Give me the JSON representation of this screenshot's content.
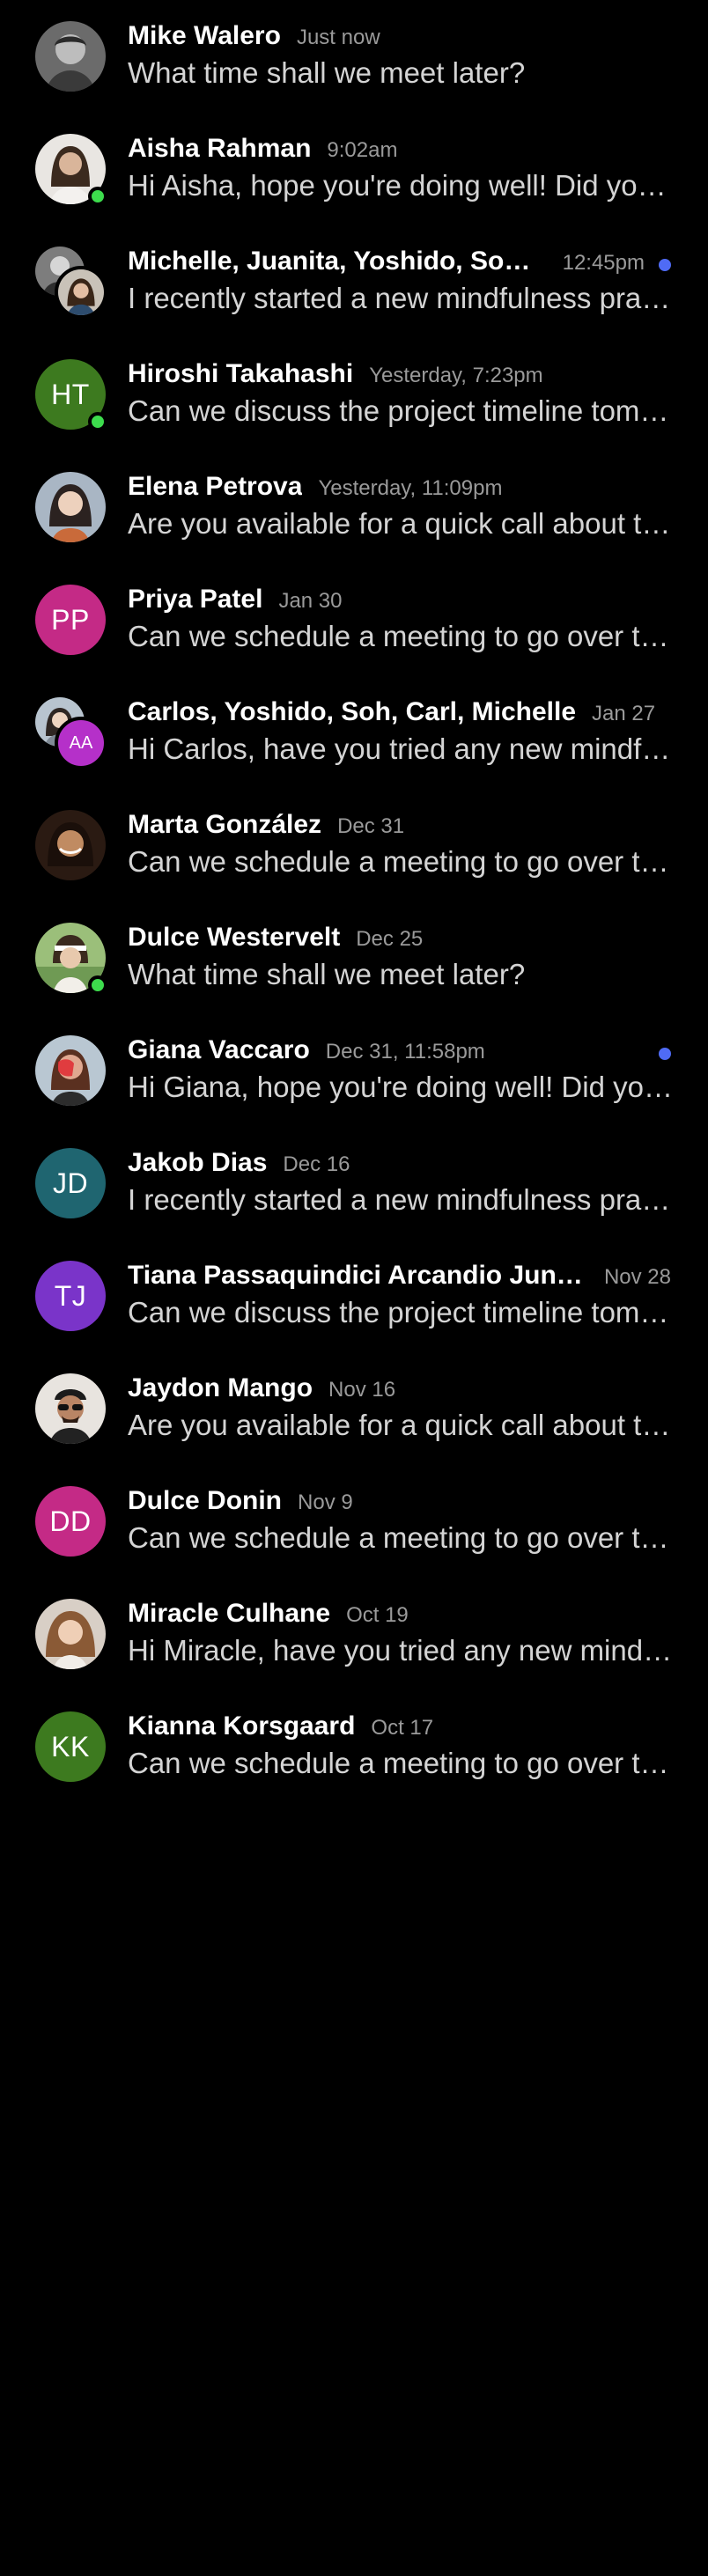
{
  "conversations": [
    {
      "name": "Mike Walero",
      "time": "Just now",
      "preview": "What time shall we meet later?",
      "avatar": "photo-mono-man",
      "online": false,
      "unread": false
    },
    {
      "name": "Aisha Rahman",
      "time": "9:02am",
      "preview": "Hi Aisha, hope you're doing well! Did you get a chance to review the draft?",
      "avatar": "photo-woman-light",
      "online": true,
      "unread": false
    },
    {
      "name": "Michelle, Juanita, Yoshido, Soh, Carl",
      "time": "12:45pm",
      "preview": "I recently started a new mindfulness practice and it has been great",
      "avatar": "group-photos",
      "online": false,
      "unread": true
    },
    {
      "name": "Hiroshi Takahashi",
      "time": "Yesterday, 7:23pm",
      "preview": "Can we discuss the project timeline tomorrow morning?",
      "avatar": "initials",
      "initials": "HT",
      "avatar_color": "#3d7a1f",
      "online": true,
      "unread": false
    },
    {
      "name": "Elena Petrova",
      "time": "Yesterday, 11:09pm",
      "preview": "Are you available for a quick call about the proposal?",
      "avatar": "photo-woman-asian",
      "online": false,
      "unread": false
    },
    {
      "name": "Priya Patel",
      "time": "Jan 30",
      "preview": "Can we schedule a meeting to go over the budget?",
      "avatar": "initials",
      "initials": "PP",
      "avatar_color": "#c42a86",
      "online": false,
      "unread": false
    },
    {
      "name": "Carlos, Yoshido, Soh, Carl, Michelle",
      "time": "Jan 27",
      "preview": "Hi Carlos, have you tried any new mindfulness apps lately?",
      "avatar": "group-photo-initials",
      "initials": "AA",
      "avatar_color": "#b530c9",
      "online": false,
      "unread": false
    },
    {
      "name": "Marta González",
      "time": "Dec 31",
      "preview": "Can we schedule a meeting to go over the budget?",
      "avatar": "photo-woman-dark",
      "online": false,
      "unread": false
    },
    {
      "name": "Dulce Westervelt",
      "time": "Dec 25",
      "preview": "What time shall we meet later?",
      "avatar": "photo-woman-outdoor",
      "online": true,
      "unread": false
    },
    {
      "name": "Giana Vaccaro",
      "time": "Dec 31, 11:58pm",
      "preview": "Hi Giana, hope you're doing well! Did you get a chance to review the draft?",
      "avatar": "photo-woman-red",
      "online": false,
      "unread": true
    },
    {
      "name": "Jakob Dias",
      "time": "Dec 16",
      "preview": "I recently started a new mindfulness practice and it has been great",
      "avatar": "initials",
      "initials": "JD",
      "avatar_color": "#1f6570",
      "online": false,
      "unread": false
    },
    {
      "name": "Tiana Passaquindici Arcandio Junior",
      "time": "Nov 28",
      "preview": "Can we discuss the project timeline tomorrow morning?",
      "avatar": "initials",
      "initials": "TJ",
      "avatar_color": "#7a34c9",
      "online": false,
      "unread": false
    },
    {
      "name": "Jaydon Mango",
      "time": "Nov 16",
      "preview": "Are you available for a quick call about the proposal?",
      "avatar": "photo-man-sunglasses",
      "online": false,
      "unread": false
    },
    {
      "name": "Dulce Donin",
      "time": "Nov 9",
      "preview": "Can we schedule a meeting to go over the budget?",
      "avatar": "initials",
      "initials": "DD",
      "avatar_color": "#c42a86",
      "online": false,
      "unread": false
    },
    {
      "name": "Miracle Culhane",
      "time": "Oct 19",
      "preview": "Hi Miracle, have you tried any new mindfulness apps lately?",
      "avatar": "photo-woman-curly",
      "online": false,
      "unread": false
    },
    {
      "name": "Kianna Korsgaard",
      "time": "Oct 17",
      "preview": "Can we schedule a meeting to go over the budget?",
      "avatar": "initials",
      "initials": "KK",
      "avatar_color": "#3d7a1f",
      "online": false,
      "unread": false
    }
  ]
}
